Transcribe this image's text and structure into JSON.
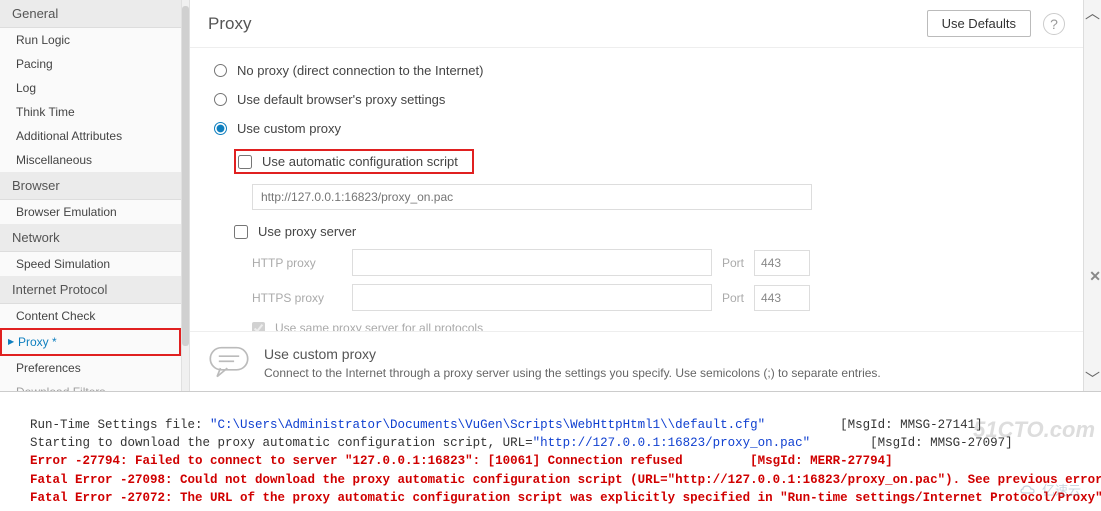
{
  "sidebar": {
    "sections": [
      {
        "title": "General",
        "items": [
          "Run Logic",
          "Pacing",
          "Log",
          "Think Time",
          "Additional Attributes",
          "Miscellaneous"
        ]
      },
      {
        "title": "Browser",
        "items": [
          "Browser Emulation"
        ]
      },
      {
        "title": "Network",
        "items": [
          "Speed Simulation"
        ]
      },
      {
        "title": "Internet Protocol",
        "items": [
          "Content Check",
          "Proxy *",
          "Preferences",
          "Download Filters"
        ]
      }
    ],
    "active": "Proxy *"
  },
  "header": {
    "title": "Proxy",
    "use_defaults": "Use Defaults"
  },
  "options": {
    "no_proxy": "No proxy (direct connection to the Internet)",
    "use_default": "Use default browser's proxy settings",
    "use_custom": "Use custom proxy",
    "auto_script": "Use automatic configuration script",
    "auto_script_placeholder": "http://127.0.0.1:16823/proxy_on.pac",
    "use_proxy_server": "Use proxy server",
    "http_label": "HTTP proxy",
    "https_label": "HTTPS proxy",
    "port_label": "Port",
    "port_value": "443",
    "same_proxy": "Use same proxy server for all protocols"
  },
  "hint": {
    "title": "Use custom proxy",
    "text": "Connect to the Internet through a proxy server using the settings you specify. Use semicolons (;) to separate entries."
  },
  "console": {
    "l1a": "Run-Time Settings file: ",
    "l1b": "\"C:\\Users\\Administrator\\Documents\\VuGen\\Scripts\\WebHttpHtml1\\\\default.cfg\"",
    "l1c": "          [MsgId: MMSG-27141]",
    "l2a": "Starting to download the proxy automatic configuration script, URL=",
    "l2b": "\"http://127.0.0.1:16823/proxy_on.pac\"",
    "l2c": "  \t[MsgId: MMSG-27097]",
    "l3": "Error -27794: Failed to connect to server \"127.0.0.1:16823\": [10061] Connection refused  \t[MsgId: MERR-27794]",
    "l4": "Fatal Error -27098: Could not download the proxy automatic configuration script (URL=\"http://127.0.0.1:16823/proxy_on.pac\"). See previous error(s)",
    "l5": "Fatal Error -27072: The URL of the proxy automatic configuration script was explicitly specified in \"Run-time settings/Internet Protocol/Proxy\". Abort"
  },
  "watermarks": {
    "w1": "51CTO.com",
    "w2": "亿速云"
  }
}
